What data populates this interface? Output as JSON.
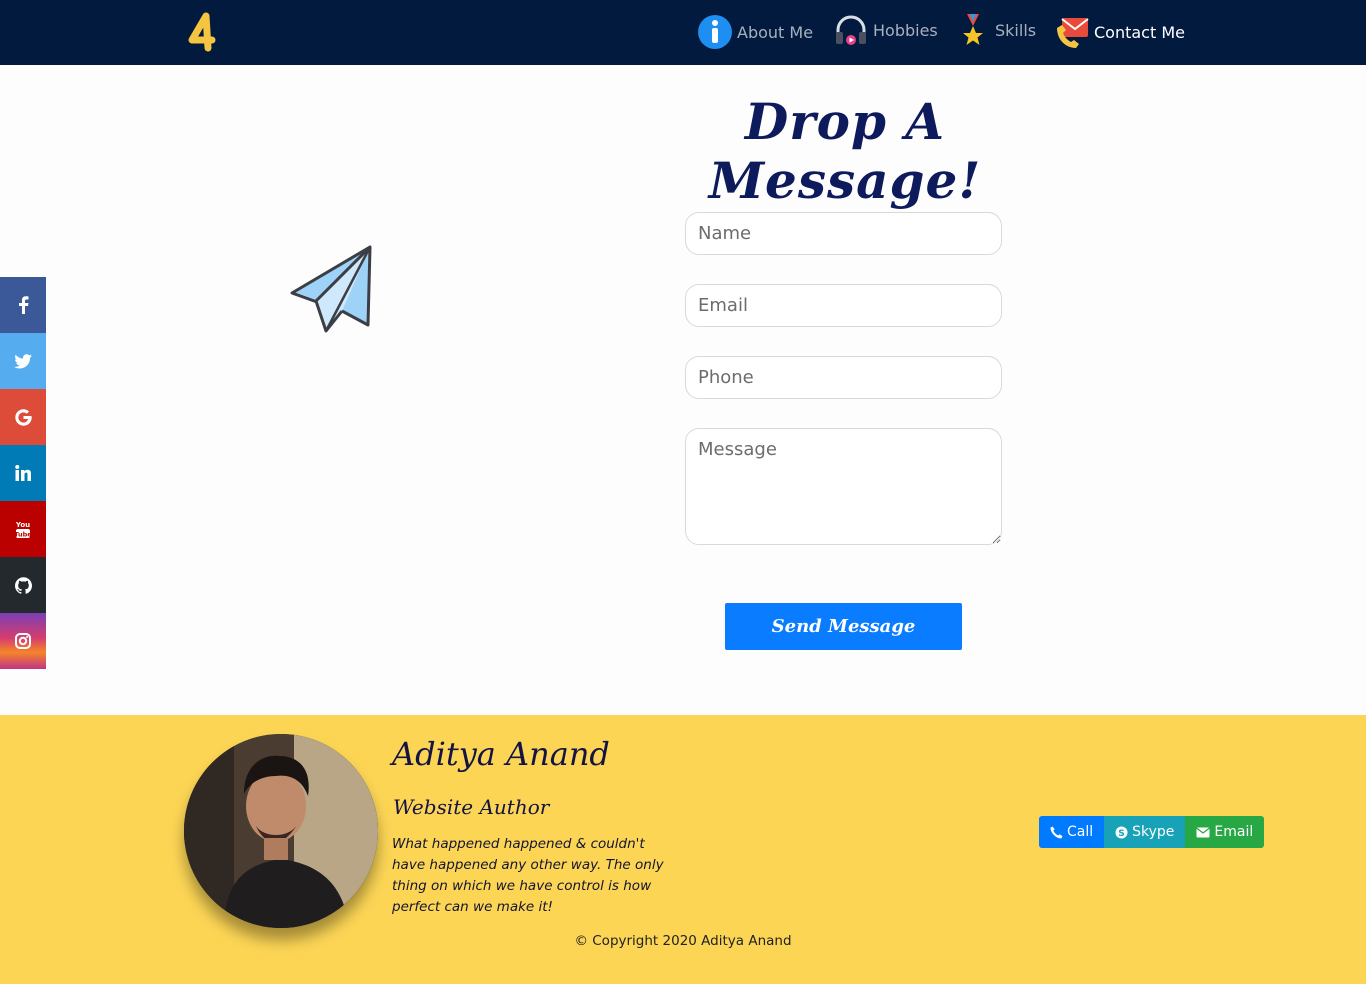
{
  "nav": {
    "logo_text": "A",
    "items": [
      {
        "label": "About Me",
        "icon": "info-icon"
      },
      {
        "label": "Hobbies",
        "icon": "headphones-icon"
      },
      {
        "label": "Skills",
        "icon": "medal-icon"
      },
      {
        "label": "Contact Me",
        "icon": "envelope-phone-icon"
      }
    ],
    "active_index": 3
  },
  "social": [
    {
      "name": "facebook",
      "icon": "facebook-icon",
      "color": "#3b5998"
    },
    {
      "name": "twitter",
      "icon": "twitter-icon",
      "color": "#55acee"
    },
    {
      "name": "google",
      "icon": "google-icon",
      "color": "#dd4b39"
    },
    {
      "name": "linkedin",
      "icon": "linkedin-icon",
      "color": "#007bb5"
    },
    {
      "name": "youtube",
      "icon": "youtube-icon",
      "color": "#bb0000"
    },
    {
      "name": "github",
      "icon": "github-icon",
      "color": "#24292e"
    },
    {
      "name": "instagram",
      "icon": "instagram-icon",
      "color": "#c13584"
    }
  ],
  "contact": {
    "heading": "Drop A Message!",
    "name_placeholder": "Name",
    "email_placeholder": "Email",
    "phone_placeholder": "Phone",
    "message_placeholder": "Message",
    "send_label": "Send Message"
  },
  "footer": {
    "author_name": "Aditya Anand",
    "author_role": "Website Author",
    "quote": "What happened happened & couldn't have happened any other way. The only thing on which we have control is how perfect can we make it!",
    "copyright": "© Copyright 2020 Aditya Anand",
    "buttons": [
      {
        "label": "Call",
        "icon": "phone-icon",
        "color": "#007bff"
      },
      {
        "label": "Skype",
        "icon": "skype-icon",
        "color": "#17a2b8"
      },
      {
        "label": "Email",
        "icon": "envelope-icon",
        "color": "#28a745"
      }
    ]
  },
  "colors": {
    "navbar": "#011a3d",
    "footer": "#fcd555",
    "heading": "#0d1a5c",
    "send_button": "#0a7cff"
  }
}
